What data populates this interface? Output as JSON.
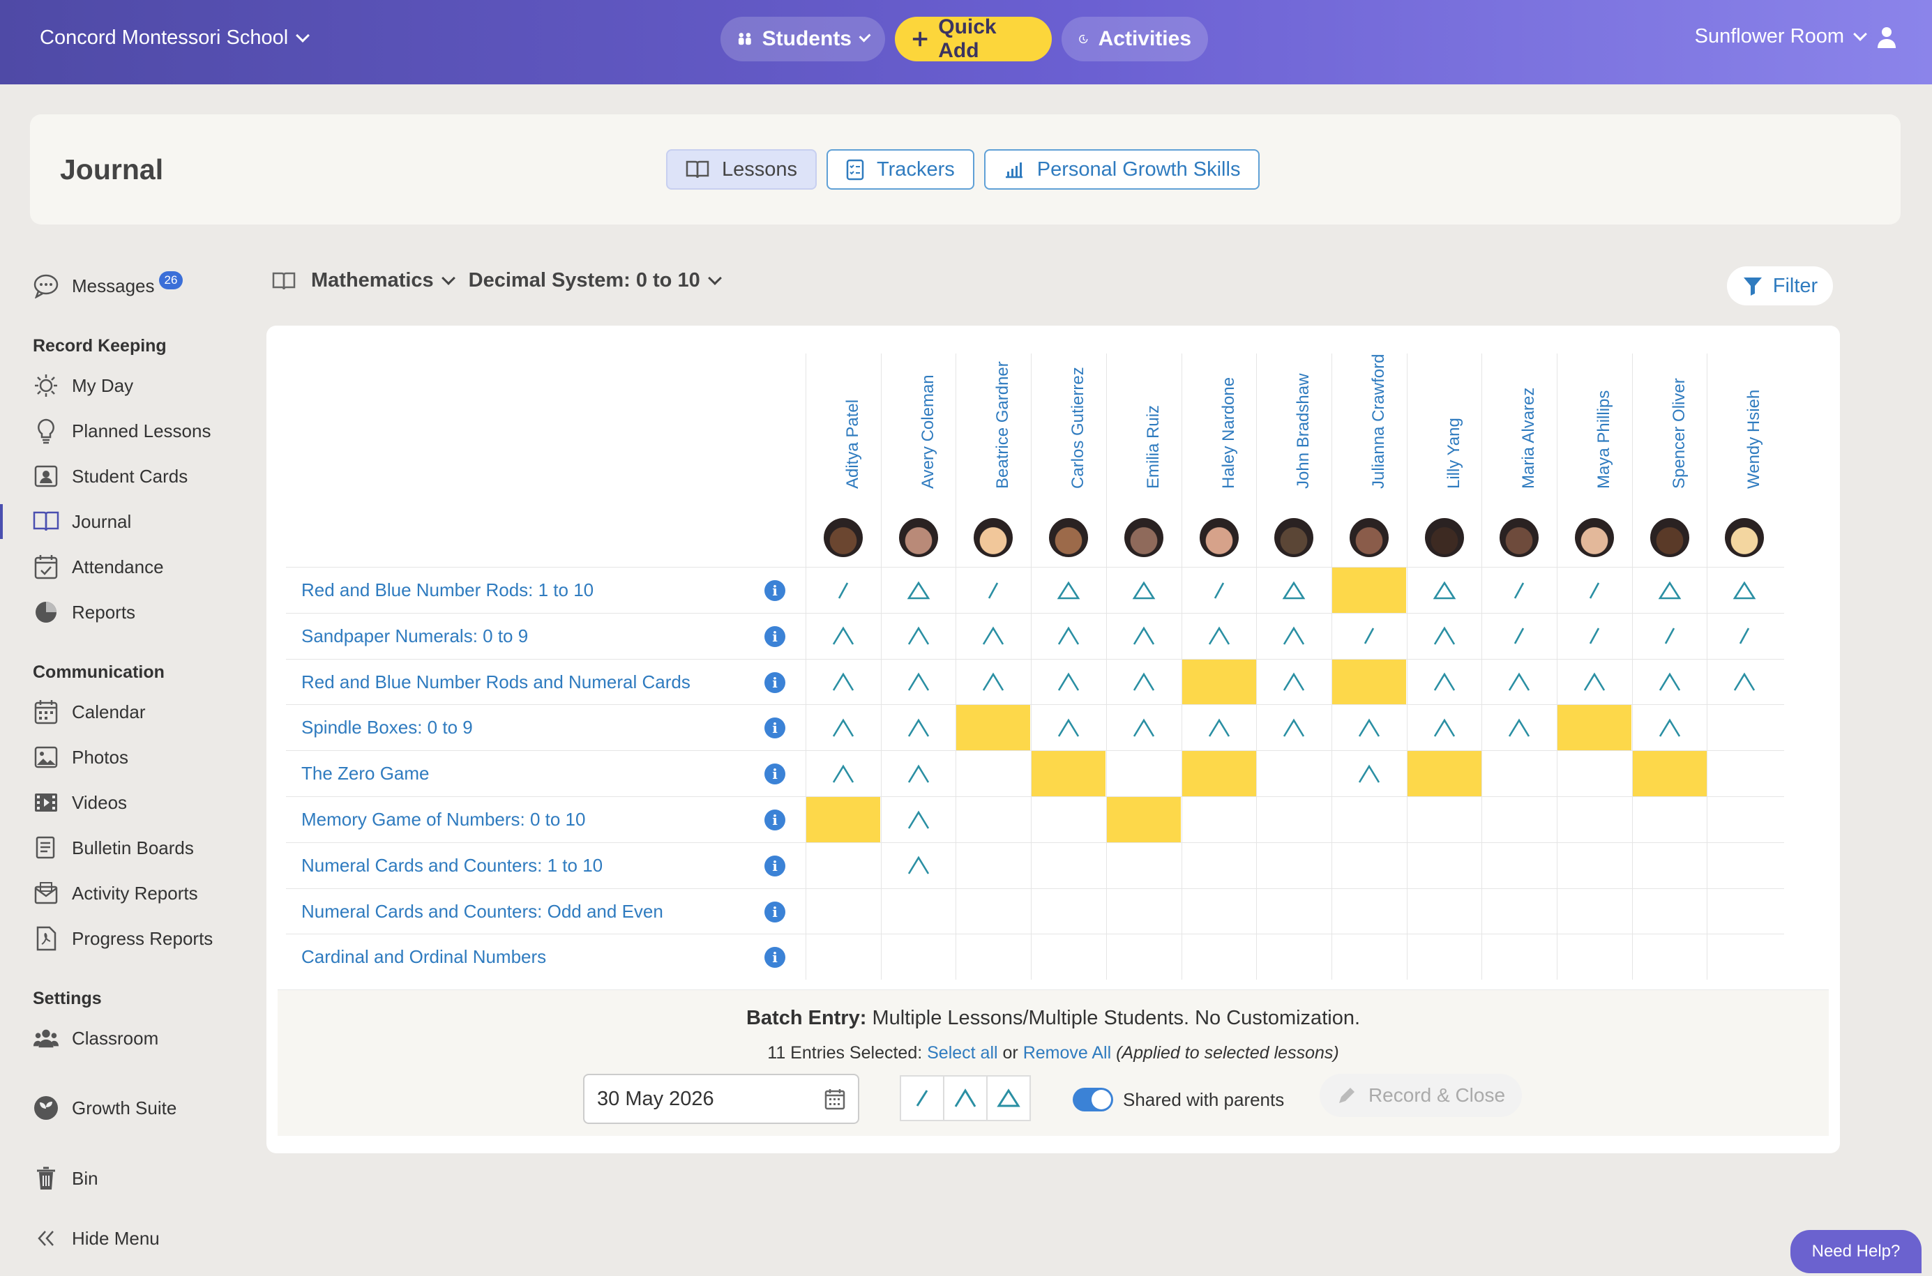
{
  "topbar": {
    "school": "Concord Montessori School",
    "students": "Students",
    "quick_add": "Quick Add",
    "activities": "Activities",
    "room": "Sunflower Room"
  },
  "header": {
    "title": "Journal",
    "tabs": [
      {
        "label": "Lessons"
      },
      {
        "label": "Trackers"
      },
      {
        "label": "Personal Growth Skills"
      }
    ]
  },
  "sidebar": {
    "messages": "Messages",
    "messages_badge": "26",
    "record_keeping": "Record Keeping",
    "rk_items": [
      {
        "label": "My Day"
      },
      {
        "label": "Planned Lessons"
      },
      {
        "label": "Student Cards"
      },
      {
        "label": "Journal"
      },
      {
        "label": "Attendance"
      },
      {
        "label": "Reports"
      }
    ],
    "communication": "Communication",
    "comm_items": [
      {
        "label": "Calendar"
      },
      {
        "label": "Photos"
      },
      {
        "label": "Videos"
      },
      {
        "label": "Bulletin Boards"
      },
      {
        "label": "Activity Reports"
      },
      {
        "label": "Progress Reports"
      }
    ],
    "settings": "Settings",
    "classroom": "Classroom",
    "growth_suite": "Growth Suite",
    "bin": "Bin",
    "hide_menu": "Hide Menu"
  },
  "subject": {
    "area": "Mathematics",
    "group": "Decimal System: 0 to 10",
    "filter": "Filter"
  },
  "students": [
    {
      "name": "Aditya Patel",
      "skin": "#6b4630"
    },
    {
      "name": "Avery Coleman",
      "skin": "#b98a78"
    },
    {
      "name": "Beatrice Gardner",
      "skin": "#f1c79a"
    },
    {
      "name": "Carlos Gutierrez",
      "skin": "#9c6a4a"
    },
    {
      "name": "Emilia Ruiz",
      "skin": "#8f6a5b"
    },
    {
      "name": "Haley Nardone",
      "skin": "#d6a28a"
    },
    {
      "name": "John Bradshaw",
      "skin": "#5b4636"
    },
    {
      "name": "Julianna Crawford",
      "skin": "#8a5c4a"
    },
    {
      "name": "Lilly Yang",
      "skin": "#3d2a22"
    },
    {
      "name": "Maria Alvarez",
      "skin": "#6e4b3c"
    },
    {
      "name": "Maya Phillips",
      "skin": "#e3b89a"
    },
    {
      "name": "Spencer Oliver",
      "skin": "#5a3a28"
    },
    {
      "name": "Wendy Hsieh",
      "skin": "#f3d6a0"
    }
  ],
  "lessons": [
    {
      "name": "Red and Blue Number Rods: 1 to 10",
      "marks": [
        "P",
        "M",
        "P",
        "M",
        "M",
        "P",
        "M",
        "H",
        "M",
        "P",
        "P",
        "M",
        "M"
      ]
    },
    {
      "name": "Sandpaper Numerals: 0 to 9",
      "marks": [
        "R",
        "R",
        "R",
        "R",
        "R",
        "R",
        "R",
        "P",
        "R",
        "P",
        "P",
        "P",
        "P"
      ]
    },
    {
      "name": "Red and Blue Number Rods and Numeral Cards",
      "marks": [
        "R",
        "R",
        "R",
        "R",
        "R",
        "H",
        "R",
        "H",
        "R",
        "R",
        "R",
        "R",
        "R"
      ]
    },
    {
      "name": "Spindle Boxes: 0 to 9",
      "marks": [
        "R",
        "R",
        "H",
        "R",
        "R",
        "R",
        "R",
        "R",
        "R",
        "R",
        "H",
        "R",
        ""
      ]
    },
    {
      "name": "The Zero Game",
      "marks": [
        "R",
        "R",
        "",
        "H",
        "",
        "H",
        "",
        "R",
        "H",
        "",
        "",
        "H",
        ""
      ]
    },
    {
      "name": "Memory Game of Numbers: 0 to 10",
      "marks": [
        "H",
        "R",
        "",
        "",
        "H",
        "",
        "",
        "",
        "",
        "",
        "",
        "",
        ""
      ]
    },
    {
      "name": "Numeral Cards and Counters: 1 to 10",
      "marks": [
        "",
        "R",
        "",
        "",
        "",
        "",
        "",
        "",
        "",
        "",
        "",
        "",
        ""
      ]
    },
    {
      "name": "Numeral Cards and Counters: Odd and Even",
      "marks": [
        "",
        "",
        "",
        "",
        "",
        "",
        "",
        "",
        "",
        "",
        "",
        "",
        ""
      ]
    },
    {
      "name": "Cardinal and Ordinal Numbers",
      "marks": [
        "",
        "",
        "",
        "",
        "",
        "",
        "",
        "",
        "",
        "",
        "",
        "",
        ""
      ]
    }
  ],
  "batch": {
    "title_bold": "Batch Entry:",
    "title_rest": " Multiple Lessons/Multiple Students. No Customization.",
    "sel_count": "11 Entries Selected: ",
    "select_all": "Select all",
    "or": " or ",
    "remove_all": "Remove All",
    "applied": " (Applied to selected lessons)",
    "date": "30 May 2026",
    "shared": "Shared with parents",
    "record": "Record & Close"
  },
  "help": "Need Help?",
  "colors": {
    "accent": "#2f7bbf",
    "highlight": "#fdd84a",
    "mark": "#2a8fa3"
  }
}
